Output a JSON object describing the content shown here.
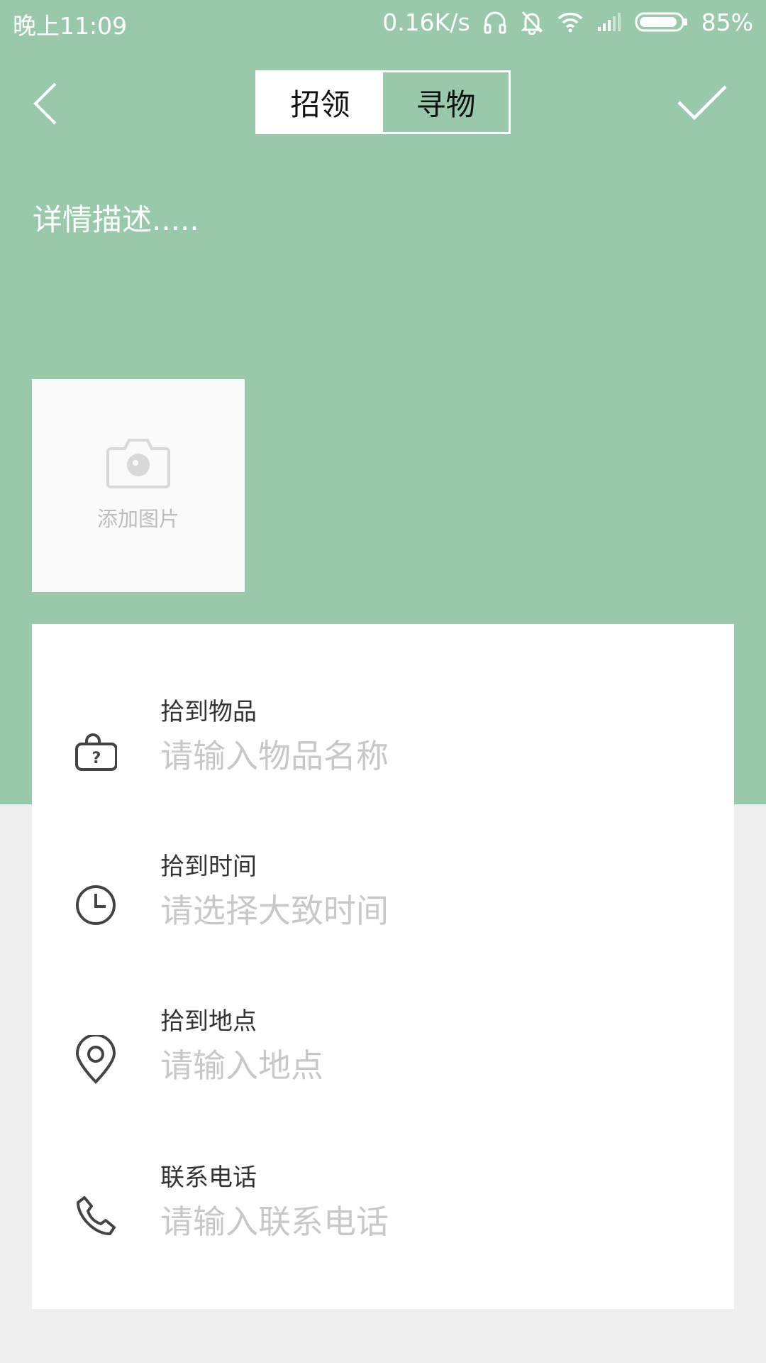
{
  "status_bar": {
    "time": "晚上11:09",
    "net_speed": "0.16K/s",
    "battery": "85%",
    "battery_level": 0.85
  },
  "header": {
    "tabs": [
      {
        "label": "招领",
        "active": true
      },
      {
        "label": "寻物",
        "active": false
      }
    ]
  },
  "description": {
    "placeholder": "详情描述....."
  },
  "photo": {
    "label": "添加图片"
  },
  "form": {
    "rows": [
      {
        "icon": "lock-question-icon",
        "label": "拾到物品",
        "placeholder": "请输入物品名称"
      },
      {
        "icon": "clock-icon",
        "label": "拾到时间",
        "placeholder": "请选择大致时间"
      },
      {
        "icon": "location-pin-icon",
        "label": "拾到地点",
        "placeholder": "请输入地点"
      },
      {
        "icon": "phone-icon",
        "label": "联系电话",
        "placeholder": "请输入联系电话"
      }
    ]
  },
  "colors": {
    "primary_green": "#99c9aa",
    "page_background": "#efefef",
    "card_background": "#ffffff",
    "placeholder_gray": "#c8c8c8"
  }
}
